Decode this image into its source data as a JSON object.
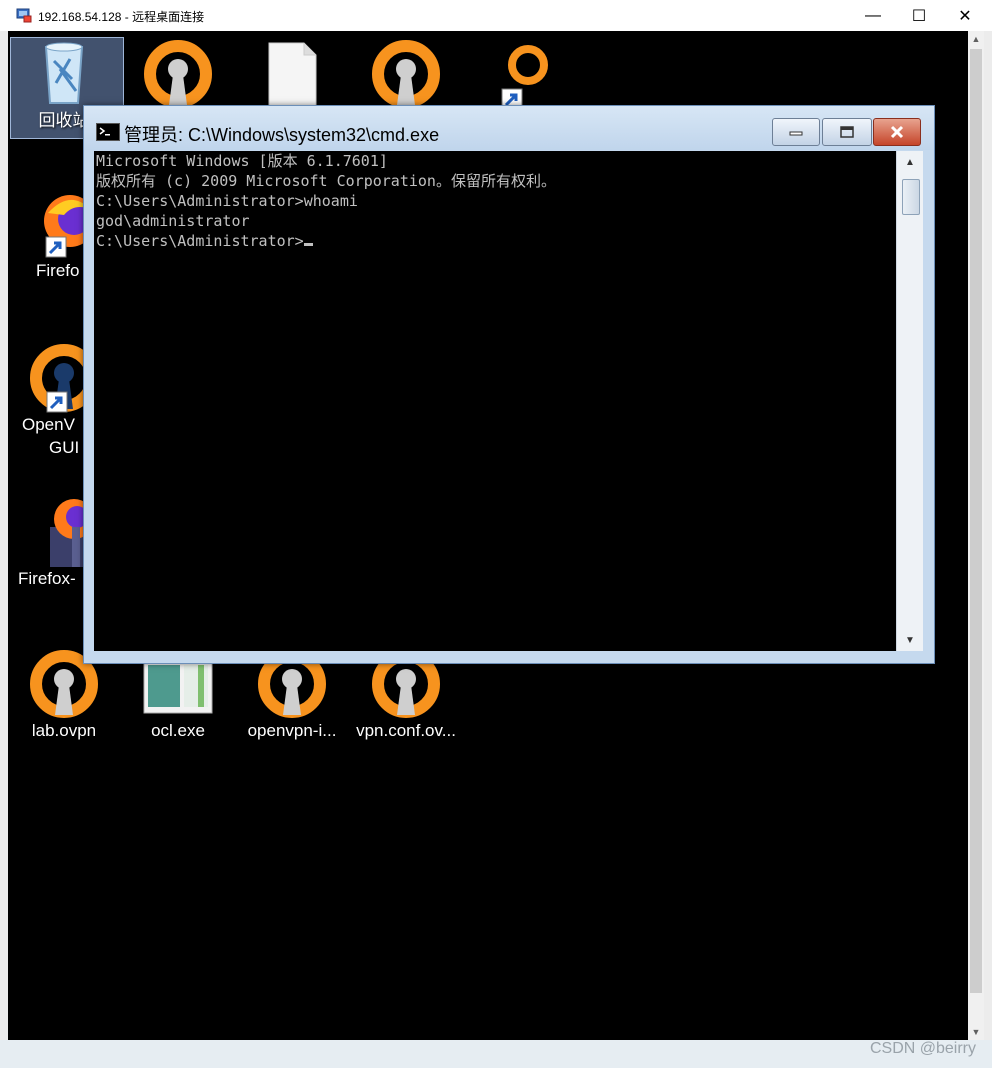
{
  "rdp_window": {
    "title": "192.168.54.128 - 远程桌面连接",
    "minimize_glyph": "—",
    "maximize_glyph": "☐",
    "close_glyph": "✕"
  },
  "desktop": {
    "icons": [
      {
        "label": "回收站",
        "icon": "recycle-bin-icon"
      },
      {
        "label": "",
        "icon": "openvpn-icon"
      },
      {
        "label": "",
        "icon": "blank-file-icon"
      },
      {
        "label": "",
        "icon": "openvpn-icon"
      },
      {
        "label": "",
        "icon": "search-shortcut-icon"
      },
      {
        "label": "Firefo",
        "icon": "firefox-icon"
      },
      {
        "label": "OpenV",
        "label2": "GUI",
        "icon": "openvpn-gui-icon"
      },
      {
        "label": "Firefox-",
        "icon": "firefox-installer-icon"
      },
      {
        "label": "lab.ovpn",
        "icon": "openvpn-icon"
      },
      {
        "label": "ocl.exe",
        "icon": "ocl-exe-icon"
      },
      {
        "label": "openvpn-i...",
        "icon": "openvpn-icon"
      },
      {
        "label": "vpn.conf.ov...",
        "icon": "openvpn-icon"
      }
    ]
  },
  "cmd_window": {
    "title": "管理员: C:\\Windows\\system32\\cmd.exe",
    "lines": [
      "Microsoft Windows [版本 6.1.7601]",
      "版权所有 (c) 2009 Microsoft Corporation。保留所有权利。",
      "",
      "C:\\Users\\Administrator>whoami",
      "god\\administrator",
      "",
      "C:\\Users\\Administrator>"
    ]
  },
  "watermark": "CSDN @beirry",
  "colors": {
    "console_bg": "#000000",
    "console_text": "#c0c0c0",
    "openvpn_orange": "#f7931e",
    "close_red": "#c5452a"
  }
}
